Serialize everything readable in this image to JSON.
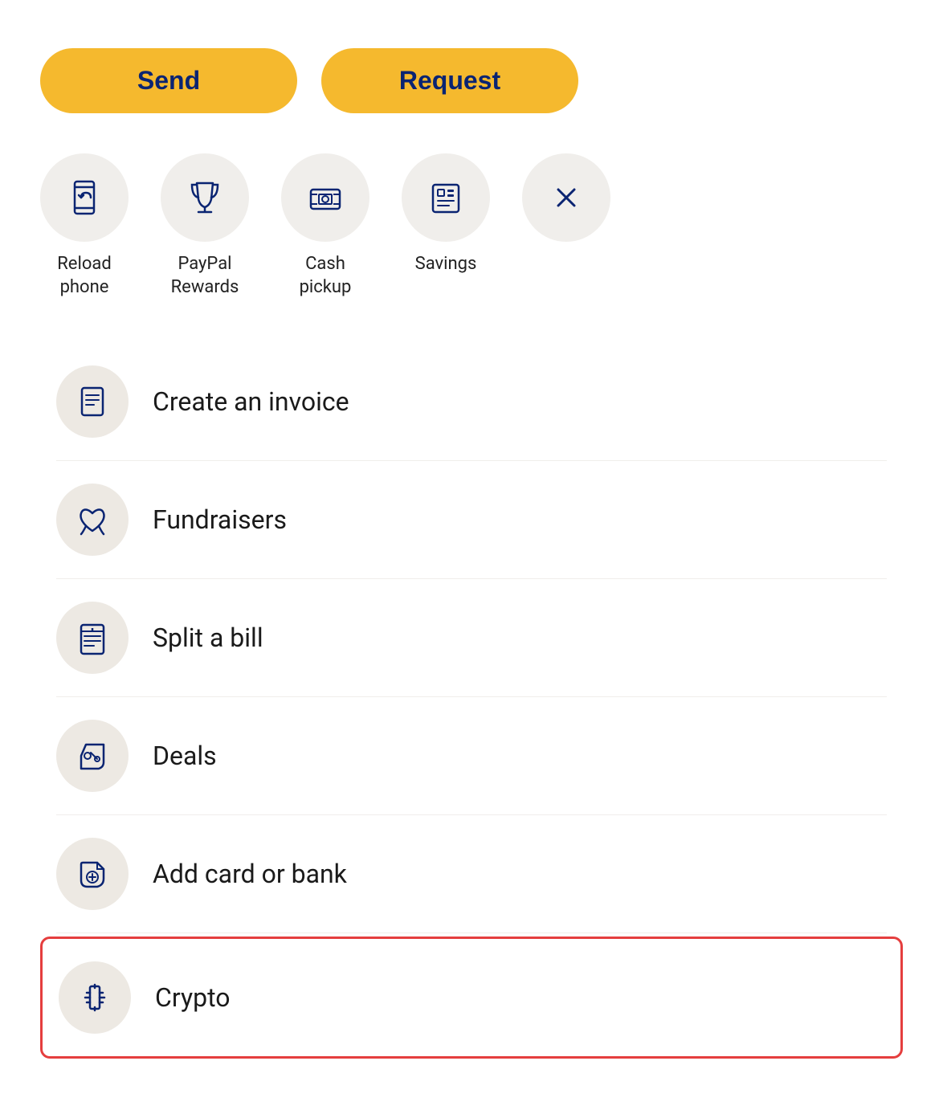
{
  "buttons": {
    "send_label": "Send",
    "request_label": "Request"
  },
  "quick_actions": [
    {
      "id": "reload-phone",
      "label": "Reload\nphone",
      "icon": "reload-phone-icon"
    },
    {
      "id": "paypal-rewards",
      "label": "PayPal\nRewards",
      "icon": "trophy-icon"
    },
    {
      "id": "cash-pickup",
      "label": "Cash\npickup",
      "icon": "cash-pickup-icon"
    },
    {
      "id": "savings",
      "label": "Savings",
      "icon": "savings-icon"
    },
    {
      "id": "close",
      "label": "",
      "icon": "close-icon"
    }
  ],
  "menu_items": [
    {
      "id": "create-invoice",
      "label": "Create an invoice",
      "icon": "invoice-icon",
      "highlighted": false
    },
    {
      "id": "fundraisers",
      "label": "Fundraisers",
      "icon": "fundraisers-icon",
      "highlighted": false
    },
    {
      "id": "split-bill",
      "label": "Split a bill",
      "icon": "split-bill-icon",
      "highlighted": false
    },
    {
      "id": "deals",
      "label": "Deals",
      "icon": "deals-icon",
      "highlighted": false
    },
    {
      "id": "add-card-bank",
      "label": "Add card or bank",
      "icon": "add-card-icon",
      "highlighted": false
    },
    {
      "id": "crypto",
      "label": "Crypto",
      "icon": "crypto-icon",
      "highlighted": true
    }
  ],
  "colors": {
    "accent": "#F5B92E",
    "dark_blue": "#0a2472",
    "icon_bg": "#f0eeeb",
    "menu_bg": "#ede9e3"
  }
}
